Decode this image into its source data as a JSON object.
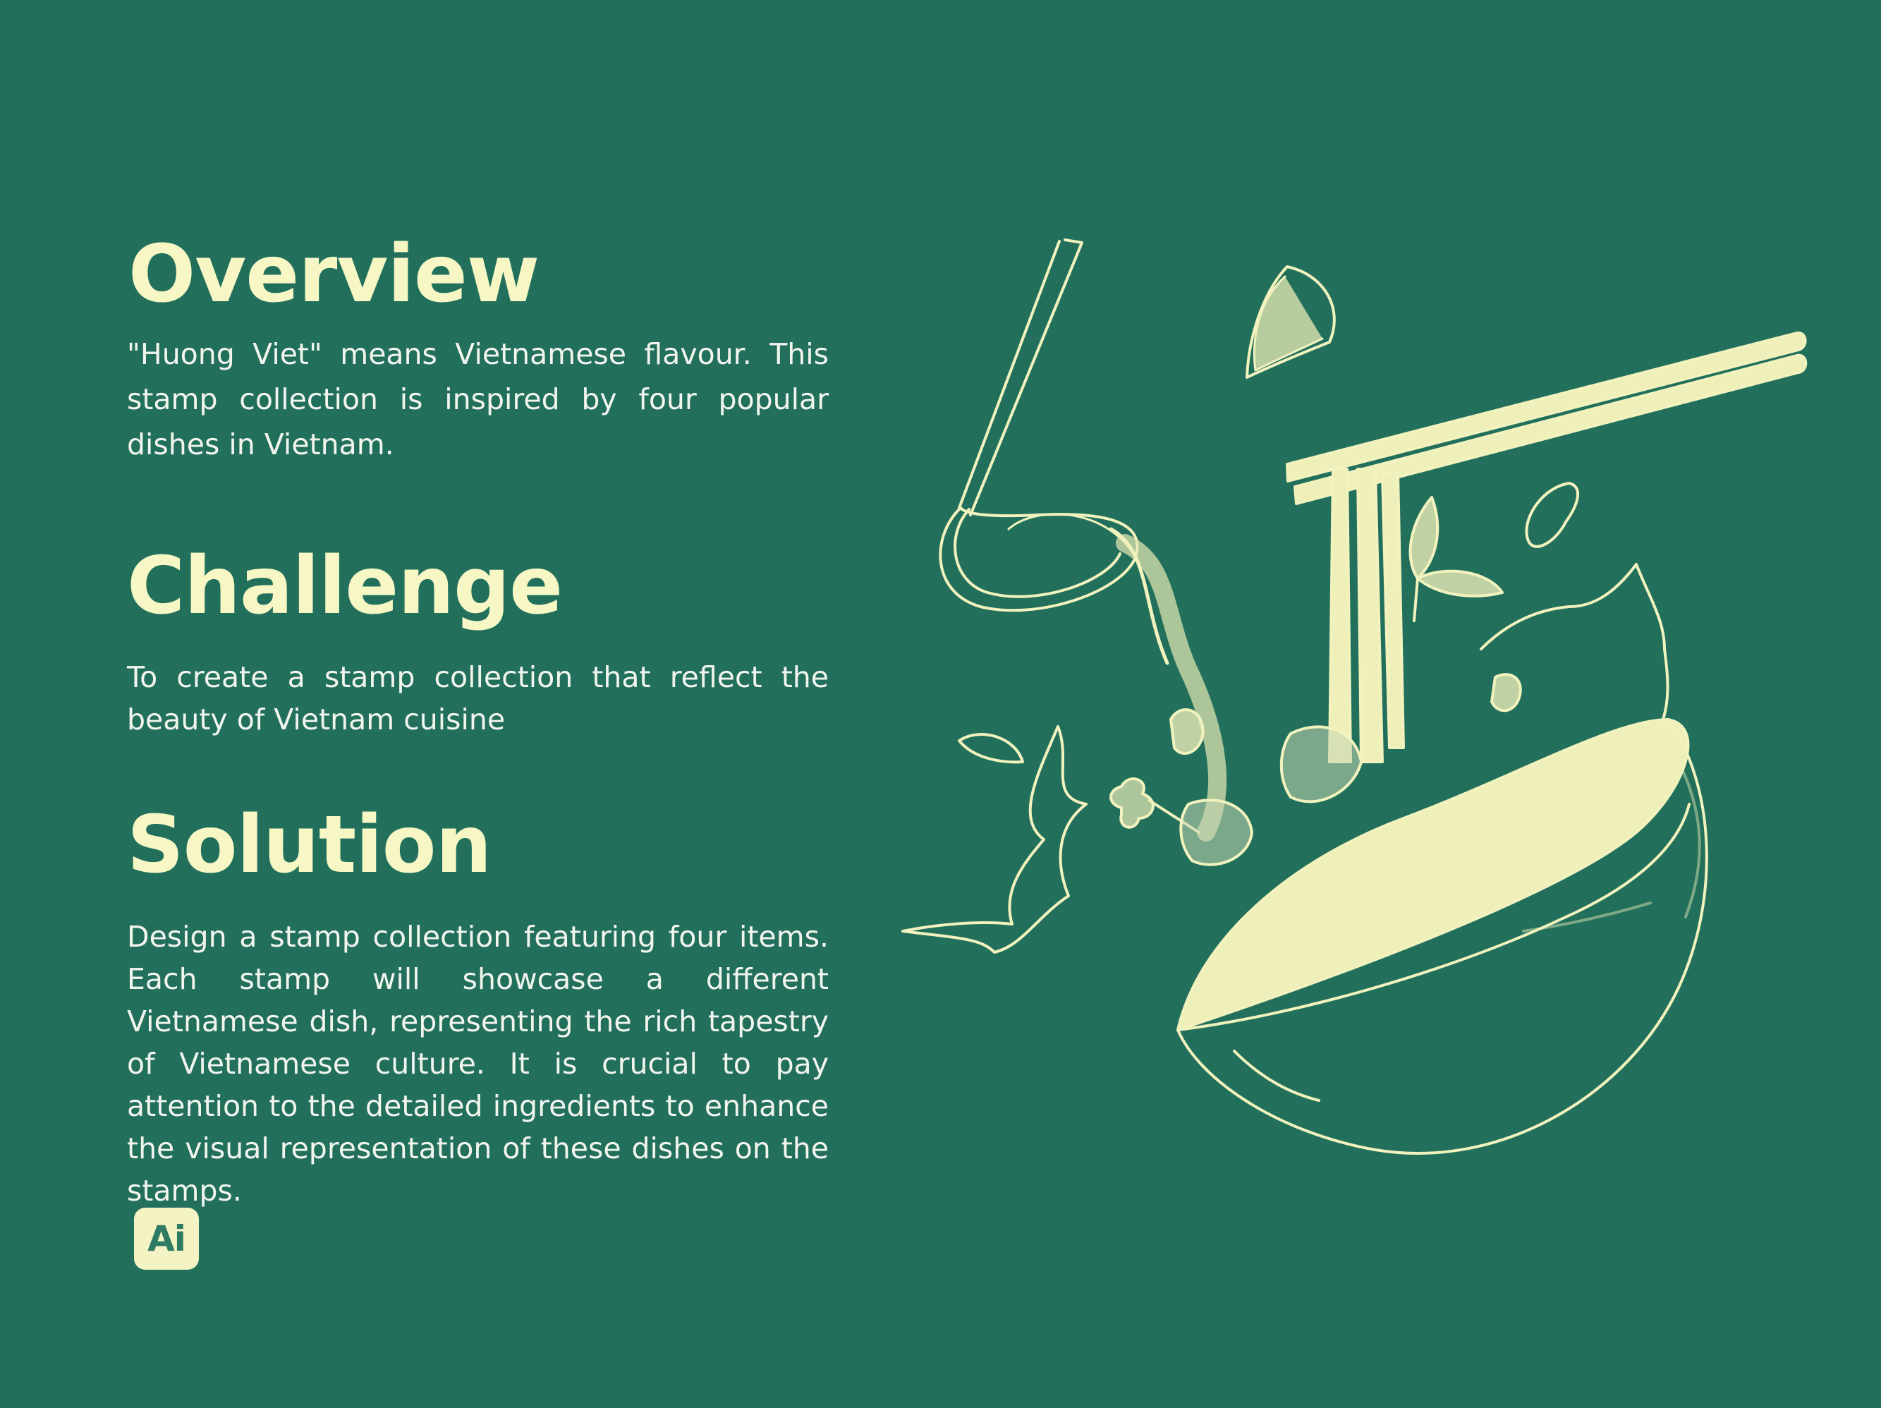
{
  "sections": {
    "overview": {
      "title": "Overview",
      "body": "\"Huong Viet\" means  Vietnamese flavour. This stamp collection is inspired by four popular dishes in Vietnam."
    },
    "challenge": {
      "title": "Challenge",
      "body": "To create a stamp collection that reflect the beauty of Vietnam cuisine"
    },
    "solution": {
      "title": "Solution",
      "body": "Design a stamp collection featuring four items. Each stamp will showcase a different Vietnamese dish, representing the rich tapestry of Vietnamese culture. It is crucial to pay  attention to the detailed ingredients to enhance the visual representation of these dishes on the stamps."
    }
  },
  "badge": {
    "label": "Ai",
    "icon": "adobe-illustrator-icon"
  },
  "illustration": {
    "subject": "pho-bowl-illustration"
  },
  "colors": {
    "background": "#22705c",
    "accent": "#f6f7c4",
    "body_text": "#f2f4ee"
  }
}
